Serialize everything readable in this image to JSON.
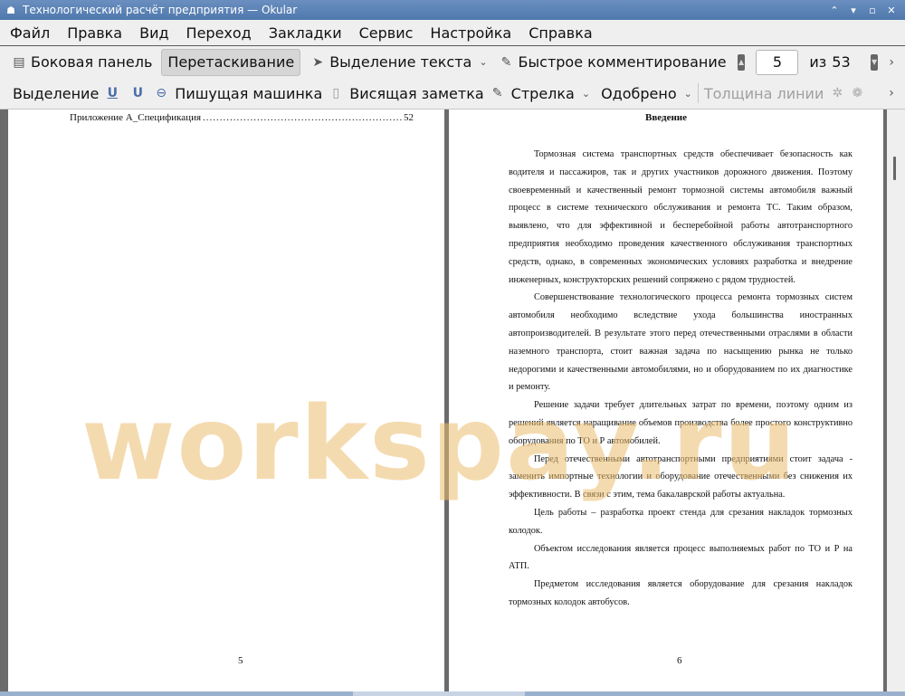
{
  "window": {
    "title": "Технологический расчёт предприятия  — Okular"
  },
  "menu": [
    "Файл",
    "Правка",
    "Вид",
    "Переход",
    "Закладки",
    "Сервис",
    "Настройка",
    "Справка"
  ],
  "toolbar1": {
    "sidebar": "Боковая панель",
    "drag": "Перетаскивание",
    "text_select": "Выделение текста",
    "quick_annot": "Быстрое комментирование",
    "page_current": "5",
    "page_of": "из",
    "page_total": "53"
  },
  "toolbar2": {
    "selection": "Выделение",
    "typewriter": "Пишущая машинка",
    "note": "Висящая заметка",
    "arrow": "Стрелка",
    "approved": "Одобрено",
    "line_width": "Толщина линии"
  },
  "left_page": {
    "toc_label": "Приложение А_Спецификация",
    "toc_dots": "................................................................................................................................................................",
    "toc_page": "52",
    "number": "5"
  },
  "right_page": {
    "heading": "Введение",
    "paragraphs": [
      "Тормозная система транспортных средств обеспечивает безопасность как водителя и пассажиров, так и других участников дорожного движения. Поэтому своевременный и качественный ремонт тормозной системы автомобиля важный процесс в системе технического обслуживания и ремонта ТС. Таким образом, выявлено, что для эффективной и бесперебойной работы автотранспортного предприятия необходимо проведения качественного обслуживания транспортных средств, однако, в современных экономических условиях разработка и внедрение инженерных, конструкторских решений сопряжено с рядом трудностей.",
      "Совершенствование технологического процесса ремонта тормозных систем автомобиля необходимо вследствие ухода большинства иностранных автопроизводителей. В результате этого перед отечественными отраслями в области наземного транспорта, стоит важная задача по насыщению рынка не только недорогими и качественными автомобилями, но и оборудованием по их диагностике и ремонту.",
      "Решение задачи требует длительных затрат по времени, поэтому одним из решений является наращивание объемов производства более простого конструктивно оборудования по ТО и Р автомобилей.",
      "Перед отечественными автотранспортными предприятиями стоит задача - заменить импортные технологии и оборудование отечественными без снижения их эффективности. В связи с этим, тема бакалаврской работы актуальна.",
      "Цель работы – разработка проект стенда для срезания накладок тормозных колодок.",
      "Объектом исследования является процесс выполняемых работ по ТО и Р на АТП.",
      "Предметом исследования является оборудование для срезания накладок тормозных колодок автобусов."
    ],
    "number": "6"
  },
  "watermark": "workspay.ru"
}
